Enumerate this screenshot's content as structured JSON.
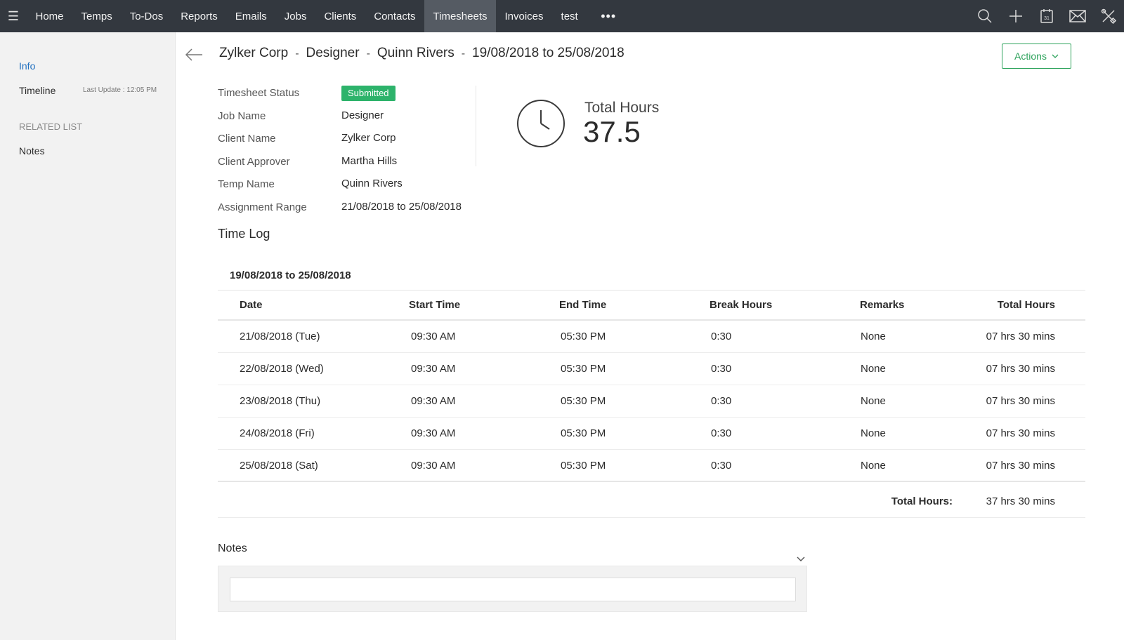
{
  "nav": {
    "items": [
      "Home",
      "Temps",
      "To-Dos",
      "Reports",
      "Emails",
      "Jobs",
      "Clients",
      "Contacts",
      "Timesheets",
      "Invoices",
      "test"
    ],
    "active": "Timesheets",
    "more_icon": "more-horizontal-icon",
    "right_icons": [
      "search-icon",
      "plus-icon",
      "calendar-icon",
      "mail-icon",
      "tools-icon"
    ],
    "calendar_day": "31"
  },
  "sidebar": {
    "info": "Info",
    "timeline": "Timeline",
    "last_update": "Last Update : 12:05 PM",
    "related_list": "RELATED LIST",
    "notes": "Notes"
  },
  "header": {
    "crumbs": [
      "Zylker Corp",
      "Designer",
      "Quinn Rivers",
      "19/08/2018 to 25/08/2018"
    ],
    "separator": "-",
    "actions": "Actions"
  },
  "details": [
    {
      "label": "Timesheet Status",
      "value": "Submitted"
    },
    {
      "label": "Job Name",
      "value": "Designer"
    },
    {
      "label": "Client Name",
      "value": "Zylker Corp"
    },
    {
      "label": "Client Approver",
      "value": "Martha Hills"
    },
    {
      "label": "Temp Name",
      "value": "Quinn Rivers"
    },
    {
      "label": "Assignment Range",
      "value": "21/08/2018 to 25/08/2018"
    }
  ],
  "total": {
    "label": "Total Hours",
    "value": "37.5"
  },
  "time_log": {
    "title": "Time Log",
    "range": "19/08/2018 to 25/08/2018",
    "columns": [
      "Date",
      "Start Time",
      "End Time",
      "Break Hours",
      "Remarks",
      "Total Hours"
    ],
    "rows": [
      [
        "21/08/2018 (Tue)",
        "09:30 AM",
        "05:30 PM",
        "0:30",
        "None",
        "07 hrs 30 mins"
      ],
      [
        "22/08/2018 (Wed)",
        "09:30 AM",
        "05:30 PM",
        "0:30",
        "None",
        "07 hrs 30 mins"
      ],
      [
        "23/08/2018 (Thu)",
        "09:30 AM",
        "05:30 PM",
        "0:30",
        "None",
        "07 hrs 30 mins"
      ],
      [
        "24/08/2018 (Fri)",
        "09:30 AM",
        "05:30 PM",
        "0:30",
        "None",
        "07 hrs 30 mins"
      ],
      [
        "25/08/2018 (Sat)",
        "09:30 AM",
        "05:30 PM",
        "0:30",
        "None",
        "07 hrs 30 mins"
      ]
    ],
    "total_label": "Total Hours:",
    "total_value": "37 hrs 30 mins"
  },
  "notes": {
    "title": "Notes",
    "placeholder": ""
  },
  "colors": {
    "topbar": "#33383f",
    "active_tab": "#555b63",
    "accent_green": "#2ea35c",
    "badge_green": "#2db36b",
    "link_blue": "#1f6fbf"
  }
}
